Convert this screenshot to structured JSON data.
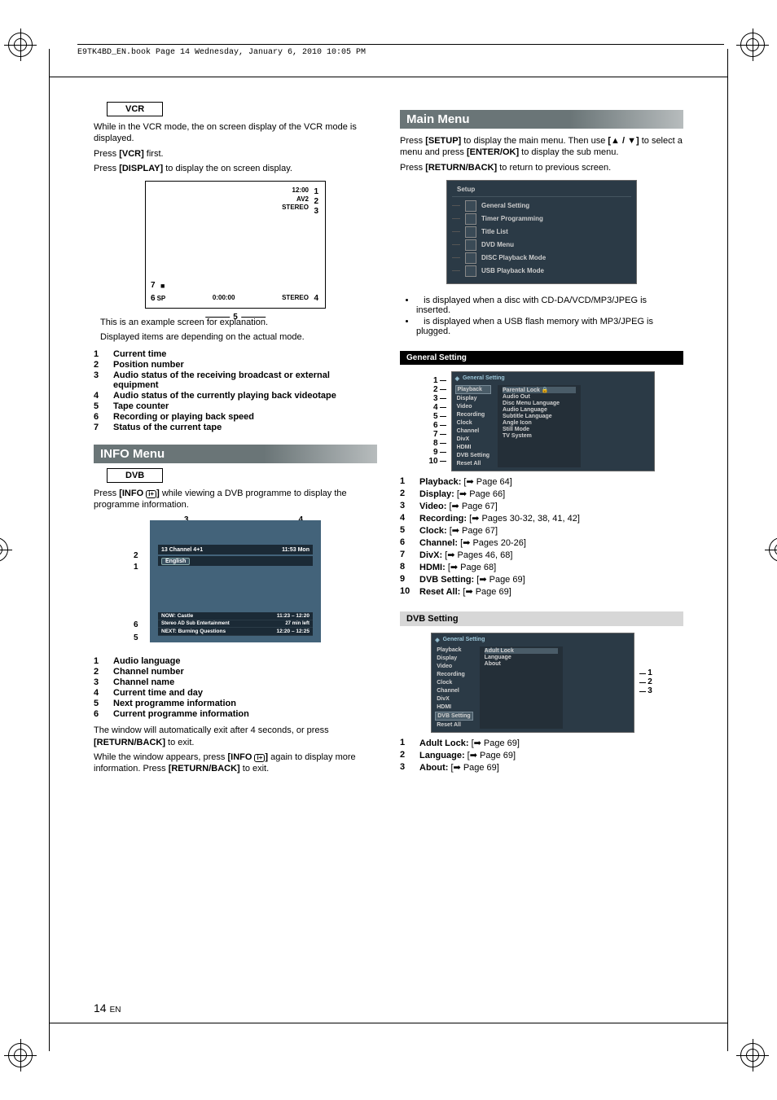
{
  "document": {
    "book_header": "E9TK4BD_EN.book  Page 14  Wednesday, January 6, 2010  10:05 PM",
    "page_number": "14",
    "page_lang": "EN"
  },
  "left": {
    "vcr_label": "VCR",
    "vcr_intro": "While in the VCR mode, the on screen display of the VCR mode is displayed.",
    "vcr_press1a": "Press ",
    "vcr_press1b": "[VCR]",
    "vcr_press1c": " first.",
    "vcr_press2a": "Press ",
    "vcr_press2b": "[DISPLAY]",
    "vcr_press2c": " to display the on screen display.",
    "osd": {
      "time": "12:00",
      "pos": "AV2",
      "audio_in": "STEREO",
      "sp": "SP",
      "counter": "0:00:00",
      "audio_tape": "STEREO",
      "c1": "1",
      "c2": "2",
      "c3": "3",
      "c4": "4",
      "c5": "5",
      "c6": "6",
      "c7": "7"
    },
    "example_note1": "This is an example screen for explanation.",
    "example_note2": "Displayed items are depending on the actual mode.",
    "vcr_items": {
      "i1": "Current time",
      "i2": "Position number",
      "i3": "Audio status of the receiving broadcast or external equipment",
      "i4": "Audio status of the currently playing back videotape",
      "i5": "Tape counter",
      "i6": "Recording or playing back speed",
      "i7": "Status of the current tape"
    },
    "info_header": "INFO Menu",
    "dvb_label": "DVB",
    "dvb_intro_a": "Press ",
    "dvb_intro_b": "[INFO ",
    "dvb_intro_c": "]",
    "dvb_intro_d": " while viewing a DVB programme to display the programme information.",
    "dvb_screen": {
      "chnum": "13",
      "chname": "Channel 4+1",
      "clock": "11:53 Mon",
      "lang": "English",
      "now": "NOW: Castle",
      "now_time": "11:23 – 12:20",
      "row2_left": "Stereo    AD    Sub    Entertainment",
      "row2_right": "27 min left",
      "next": "NEXT: Burning Questions",
      "next_time": "12:20 – 12:25",
      "c1": "1",
      "c2": "2",
      "c3": "3",
      "c4": "4",
      "c5": "5",
      "c6": "6"
    },
    "dvb_items": {
      "i1": "Audio language",
      "i2": "Channel number",
      "i3": "Channel name",
      "i4": "Current time and day",
      "i5": "Next programme information",
      "i6": "Current programme information"
    },
    "dvb_note1_a": "The window will automatically exit after 4 seconds, or press ",
    "dvb_note1_b": "[RETURN/BACK]",
    "dvb_note1_c": " to exit.",
    "dvb_note2_a": "While the window appears, press ",
    "dvb_note2_b": "[INFO ",
    "dvb_note2_c": "]",
    "dvb_note2_d": " again to display more information. Press ",
    "dvb_note2_e": "[RETURN/BACK]",
    "dvb_note2_f": " to exit."
  },
  "right": {
    "main_header": "Main Menu",
    "main_p1_a": "Press ",
    "main_p1_b": "[SETUP]",
    "main_p1_c": " to display the main menu. Then use ",
    "main_p1_d": "[▲ / ▼]",
    "main_p1_e": " to select a menu and press ",
    "main_p1_f": "[ENTER/OK]",
    "main_p1_g": " to display the sub menu.",
    "main_p2_a": "Press ",
    "main_p2_b": "[RETURN/BACK]",
    "main_p2_c": " to return to previous screen.",
    "setup_menu": {
      "title": "Setup",
      "items": [
        "General Setting",
        "Timer Programming",
        "Title List",
        "DVD Menu",
        "DISC Playback Mode",
        "USB Playback Mode"
      ]
    },
    "bullets": {
      "b1": "is displayed when a disc with CD-DA/VCD/MP3/JPEG is inserted.",
      "b2": "is displayed when a USB flash memory with MP3/JPEG is plugged."
    },
    "gs_header": "General Setting",
    "gs_screen1": {
      "title": "General Setting",
      "left": [
        "Playback",
        "Display",
        "Video",
        "Recording",
        "Clock",
        "Channel",
        "DivX",
        "HDMI",
        "DVB Setting",
        "Reset All"
      ],
      "right": [
        "Parental Lock",
        "Audio Out",
        "Disc Menu Language",
        "Audio Language",
        "Subtitle Language",
        "Angle Icon",
        "Still Mode",
        "TV System"
      ],
      "callouts": [
        "1",
        "2",
        "3",
        "4",
        "5",
        "6",
        "7",
        "8",
        "9",
        "10"
      ]
    },
    "gs_refs": [
      {
        "n": "1",
        "label": "Playback:",
        "page": "Page 64"
      },
      {
        "n": "2",
        "label": "Display:",
        "page": "Page 66"
      },
      {
        "n": "3",
        "label": "Video:",
        "page": "Page 67"
      },
      {
        "n": "4",
        "label": "Recording:",
        "page": "Pages 30-32, 38, 41, 42"
      },
      {
        "n": "5",
        "label": "Clock:",
        "page": "Page 67"
      },
      {
        "n": "6",
        "label": "Channel:",
        "page": "Pages 20-26"
      },
      {
        "n": "7",
        "label": "DivX:",
        "page": "Pages 46, 68"
      },
      {
        "n": "8",
        "label": "HDMI:",
        "page": "Page 68"
      },
      {
        "n": "9",
        "label": "DVB Setting:",
        "page": "Page 69"
      },
      {
        "n": "10",
        "label": "Reset All:",
        "page": "Page 69"
      }
    ],
    "dvb_setting_header": "DVB Setting",
    "gs_screen2": {
      "title": "General Setting",
      "left": [
        "Playback",
        "Display",
        "Video",
        "Recording",
        "Clock",
        "Channel",
        "DivX",
        "HDMI",
        "DVB Setting",
        "Reset All"
      ],
      "right": [
        "Adult Lock",
        "Language",
        "About"
      ],
      "callouts": [
        "1",
        "2",
        "3"
      ]
    },
    "dvb_refs": [
      {
        "n": "1",
        "label": "Adult Lock:",
        "page": "Page 69"
      },
      {
        "n": "2",
        "label": "Language:",
        "page": "Page 69"
      },
      {
        "n": "3",
        "label": "About:",
        "page": "Page 69"
      }
    ]
  }
}
